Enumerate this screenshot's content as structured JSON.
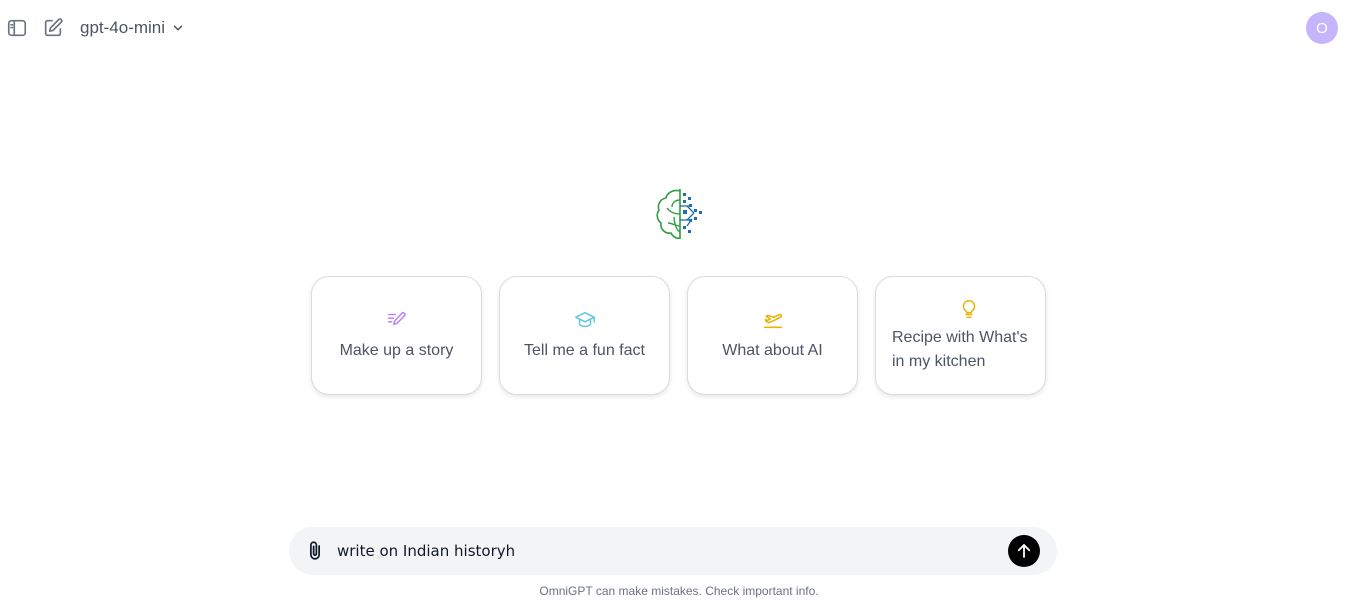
{
  "header": {
    "model_name": "gpt-4o-mini",
    "avatar_initial": "O",
    "avatar_color": "#c4b5fd"
  },
  "logo": {
    "icon": "brain-circuit-logo-icon"
  },
  "suggestions": [
    {
      "label": "Make up a story",
      "icon": "pencil-lines-icon",
      "color": "#c084fc"
    },
    {
      "label": "Tell me a fun fact",
      "icon": "graduation-cap-icon",
      "color": "#67c8e0"
    },
    {
      "label": "What about AI",
      "icon": "airplane-takeoff-icon",
      "color": "#eab308"
    },
    {
      "label": "Recipe with What's in my kitchen",
      "icon": "lightbulb-icon",
      "color": "#eab308"
    }
  ],
  "composer": {
    "value": "write on Indian historyh",
    "attach_icon": "paperclip-icon",
    "send_icon": "arrow-up-icon"
  },
  "footer": {
    "disclaimer": "OmniGPT can make mistakes. Check important info."
  }
}
